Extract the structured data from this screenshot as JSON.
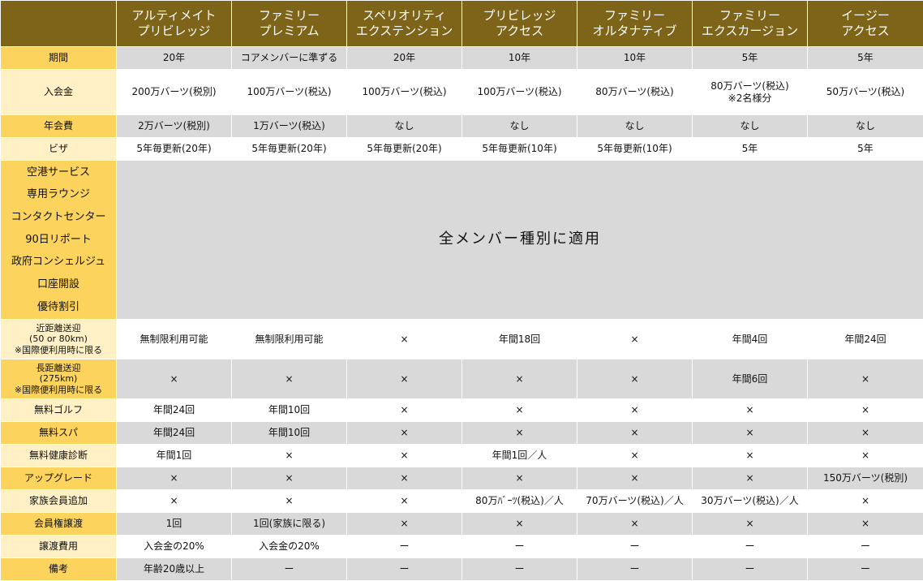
{
  "headers": [
    [
      "",
      ""
    ],
    [
      "アルティメイト",
      "プリビレッジ"
    ],
    [
      "ファミリー",
      "プレミアム"
    ],
    [
      "スペリオリティ",
      "エクステンション"
    ],
    [
      "プリビレッジ",
      "アクセス"
    ],
    [
      "ファミリー",
      "オルタナティブ"
    ],
    [
      "ファミリー",
      "エクスカージョン"
    ],
    [
      "イージー",
      "アクセス"
    ]
  ],
  "rows": {
    "period": {
      "label": "期間",
      "cells": [
        "20年",
        "コアメンバーに準ずる",
        "20年",
        "10年",
        "10年",
        "5年",
        "5年"
      ]
    },
    "entry_fee": {
      "label": "入会金",
      "cells": [
        "200万バーツ(税別)",
        "100万バーツ(税込)",
        "100万バーツ(税込)",
        "100万バーツ(税込)",
        "80万バーツ(税込)",
        "80万バーツ(税込)",
        "50万バーツ(税込)"
      ],
      "note6": "※2名様分"
    },
    "annual_fee": {
      "label": "年会費",
      "cells": [
        "2万バーツ(税別)",
        "1万バーツ(税込)",
        "なし",
        "なし",
        "なし",
        "なし",
        "なし"
      ]
    },
    "visa": {
      "label": "ビザ",
      "cells": [
        "5年毎更新(20年)",
        "5年毎更新(20年)",
        "5年毎更新(20年)",
        "5年毎更新(10年)",
        "5年毎更新(10年)",
        "5年",
        "5年"
      ]
    }
  },
  "services": {
    "labels": [
      "空港サービス",
      "専用ラウンジ",
      "コンタクトセンター",
      "90日リポート",
      "政府コンシェルジュ",
      "口座開設",
      "優待割引"
    ],
    "merged_text": "全メンバー種別に適用"
  },
  "rows2": {
    "short_transfer": {
      "label_lines": [
        "近距離送迎",
        "(50 or 80km)",
        "※国際便利用時に限る"
      ],
      "cells": [
        "無制限利用可能",
        "無制限利用可能",
        "×",
        "年間18回",
        "×",
        "年間4回",
        "年間24回"
      ]
    },
    "long_transfer": {
      "label_lines": [
        "長距離送迎",
        "(275km)",
        "※国際便利用時に限る"
      ],
      "cells": [
        "×",
        "×",
        "×",
        "×",
        "×",
        "年間6回",
        "×"
      ]
    },
    "golf": {
      "label": "無料ゴルフ",
      "cells": [
        "年間24回",
        "年間10回",
        "×",
        "×",
        "×",
        "×",
        "×"
      ]
    },
    "spa": {
      "label": "無料スパ",
      "cells": [
        "年間24回",
        "年間10回",
        "×",
        "×",
        "×",
        "×",
        "×"
      ]
    },
    "checkup": {
      "label": "無料健康診断",
      "cells": [
        "年間1回",
        "×",
        "×",
        "年間1回／人",
        "×",
        "×",
        "×"
      ]
    },
    "upgrade": {
      "label": "アップグレード",
      "cells": [
        "×",
        "×",
        "×",
        "×",
        "×",
        "×",
        "150万バーツ(税別)"
      ]
    },
    "family": {
      "label": "家族会員追加",
      "cells": [
        "×",
        "×",
        "×",
        "80万ﾊﾞｰﾂ(税込)／人",
        "70万バーツ(税込)／人",
        "30万バーツ(税込)／人",
        "×"
      ]
    },
    "transfer": {
      "label": "会員権譲渡",
      "cells": [
        "1回",
        "1回(家族に限る)",
        "×",
        "×",
        "×",
        "×",
        "×"
      ]
    },
    "transfer_fee": {
      "label": "譲渡費用",
      "cells": [
        "入会金の20%",
        "入会金の20%",
        "ー",
        "ー",
        "ー",
        "ー",
        "ー"
      ]
    },
    "remarks": {
      "label": "備考",
      "cells": [
        "年齢20歳以上",
        "ー",
        "ー",
        "ー",
        "ー",
        "ー",
        "ー"
      ]
    }
  },
  "colors": {
    "header": "#7d6418",
    "gold": "#fcd35c",
    "cream": "#fff0c5",
    "gray": "#d9d9d9"
  }
}
